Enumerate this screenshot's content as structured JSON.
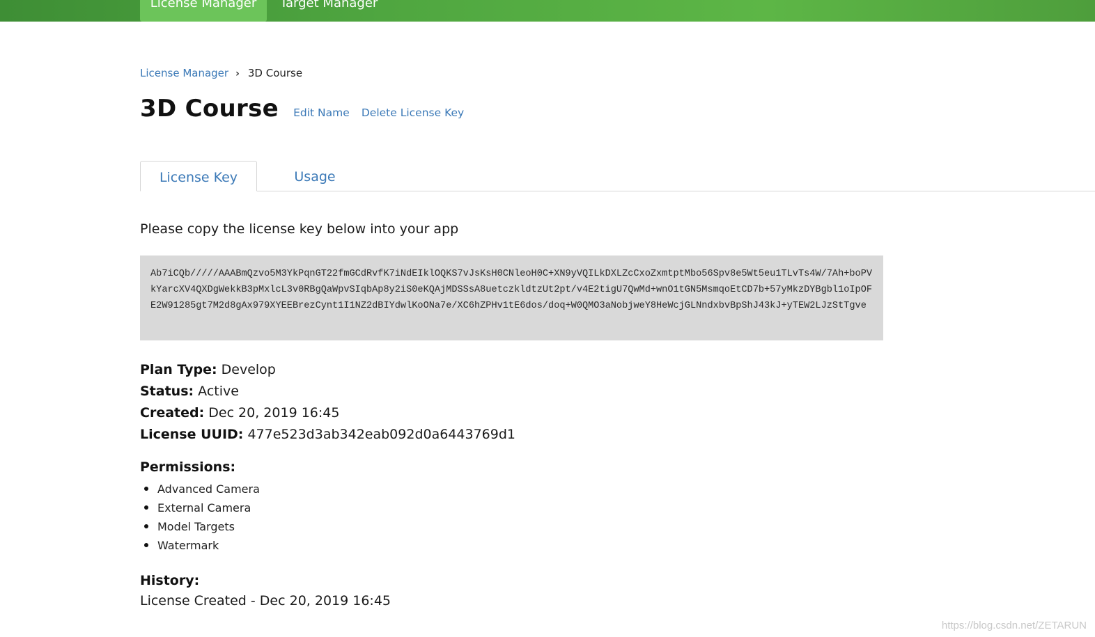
{
  "topnav": {
    "tabs": [
      {
        "label": "License Manager",
        "active": true
      },
      {
        "label": "Target Manager",
        "active": false
      }
    ],
    "colors": {
      "bar": "#4fa640",
      "active_tab": "#6cc45a"
    }
  },
  "breadcrumb": {
    "parent": "License Manager",
    "separator": "›",
    "current": "3D Course"
  },
  "header": {
    "title": "3D Course",
    "edit_name": "Edit Name",
    "delete_key": "Delete License Key"
  },
  "tabs": [
    {
      "label": "License Key",
      "active": true
    },
    {
      "label": "Usage",
      "active": false
    }
  ],
  "license": {
    "instruction": "Please copy the license key below into your app",
    "key": "Ab7iCQb/////AAABmQzvo5M3YkPqnGT22fmGCdRvfK7iNdEIklOQKS7vJsKsH0CNleoH0C+XN9yVQILkDXLZcCxoZxmtptMbo56Spv8e5Wt5eu1TLvTs4W/7Ah+boPVkYarcXV4QXDgWekkB3pMxlcL3v0RBgQaWpvSIqbAp8y2iS0eKQAjMDSSsA8uetczkldtzUt2pt/v4E2tigU7QwMd+wnO1tGN5MsmqoEtCD7b+57yMkzDYBgbl1oIpOFE2W91285gt7M2d8gAx979XYEEBrezCynt1I1NZ2dBIYdwlKoONa7e/XC6hZPHv1tE6dos/doq+W0QMO3aNobjweY8HeWcjGLNndxbvBpShJ43kJ+yTEW2LJzStTgve"
  },
  "details": [
    {
      "label": "Plan Type:",
      "value": "Develop"
    },
    {
      "label": "Status:",
      "value": "Active"
    },
    {
      "label": "Created:",
      "value": "Dec 20, 2019 16:45"
    },
    {
      "label": "License UUID:",
      "value": "477e523d3ab342eab092d0a6443769d1"
    }
  ],
  "permissions": {
    "heading": "Permissions:",
    "items": [
      "Advanced Camera",
      "External Camera",
      "Model Targets",
      "Watermark"
    ]
  },
  "history": {
    "heading": "History:",
    "entry": "License Created - Dec 20, 2019 16:45"
  },
  "watermark": "https://blog.csdn.net/ZETARUN",
  "colors": {
    "link": "#3b79b7",
    "key_box_bg": "#d9d9d9"
  }
}
